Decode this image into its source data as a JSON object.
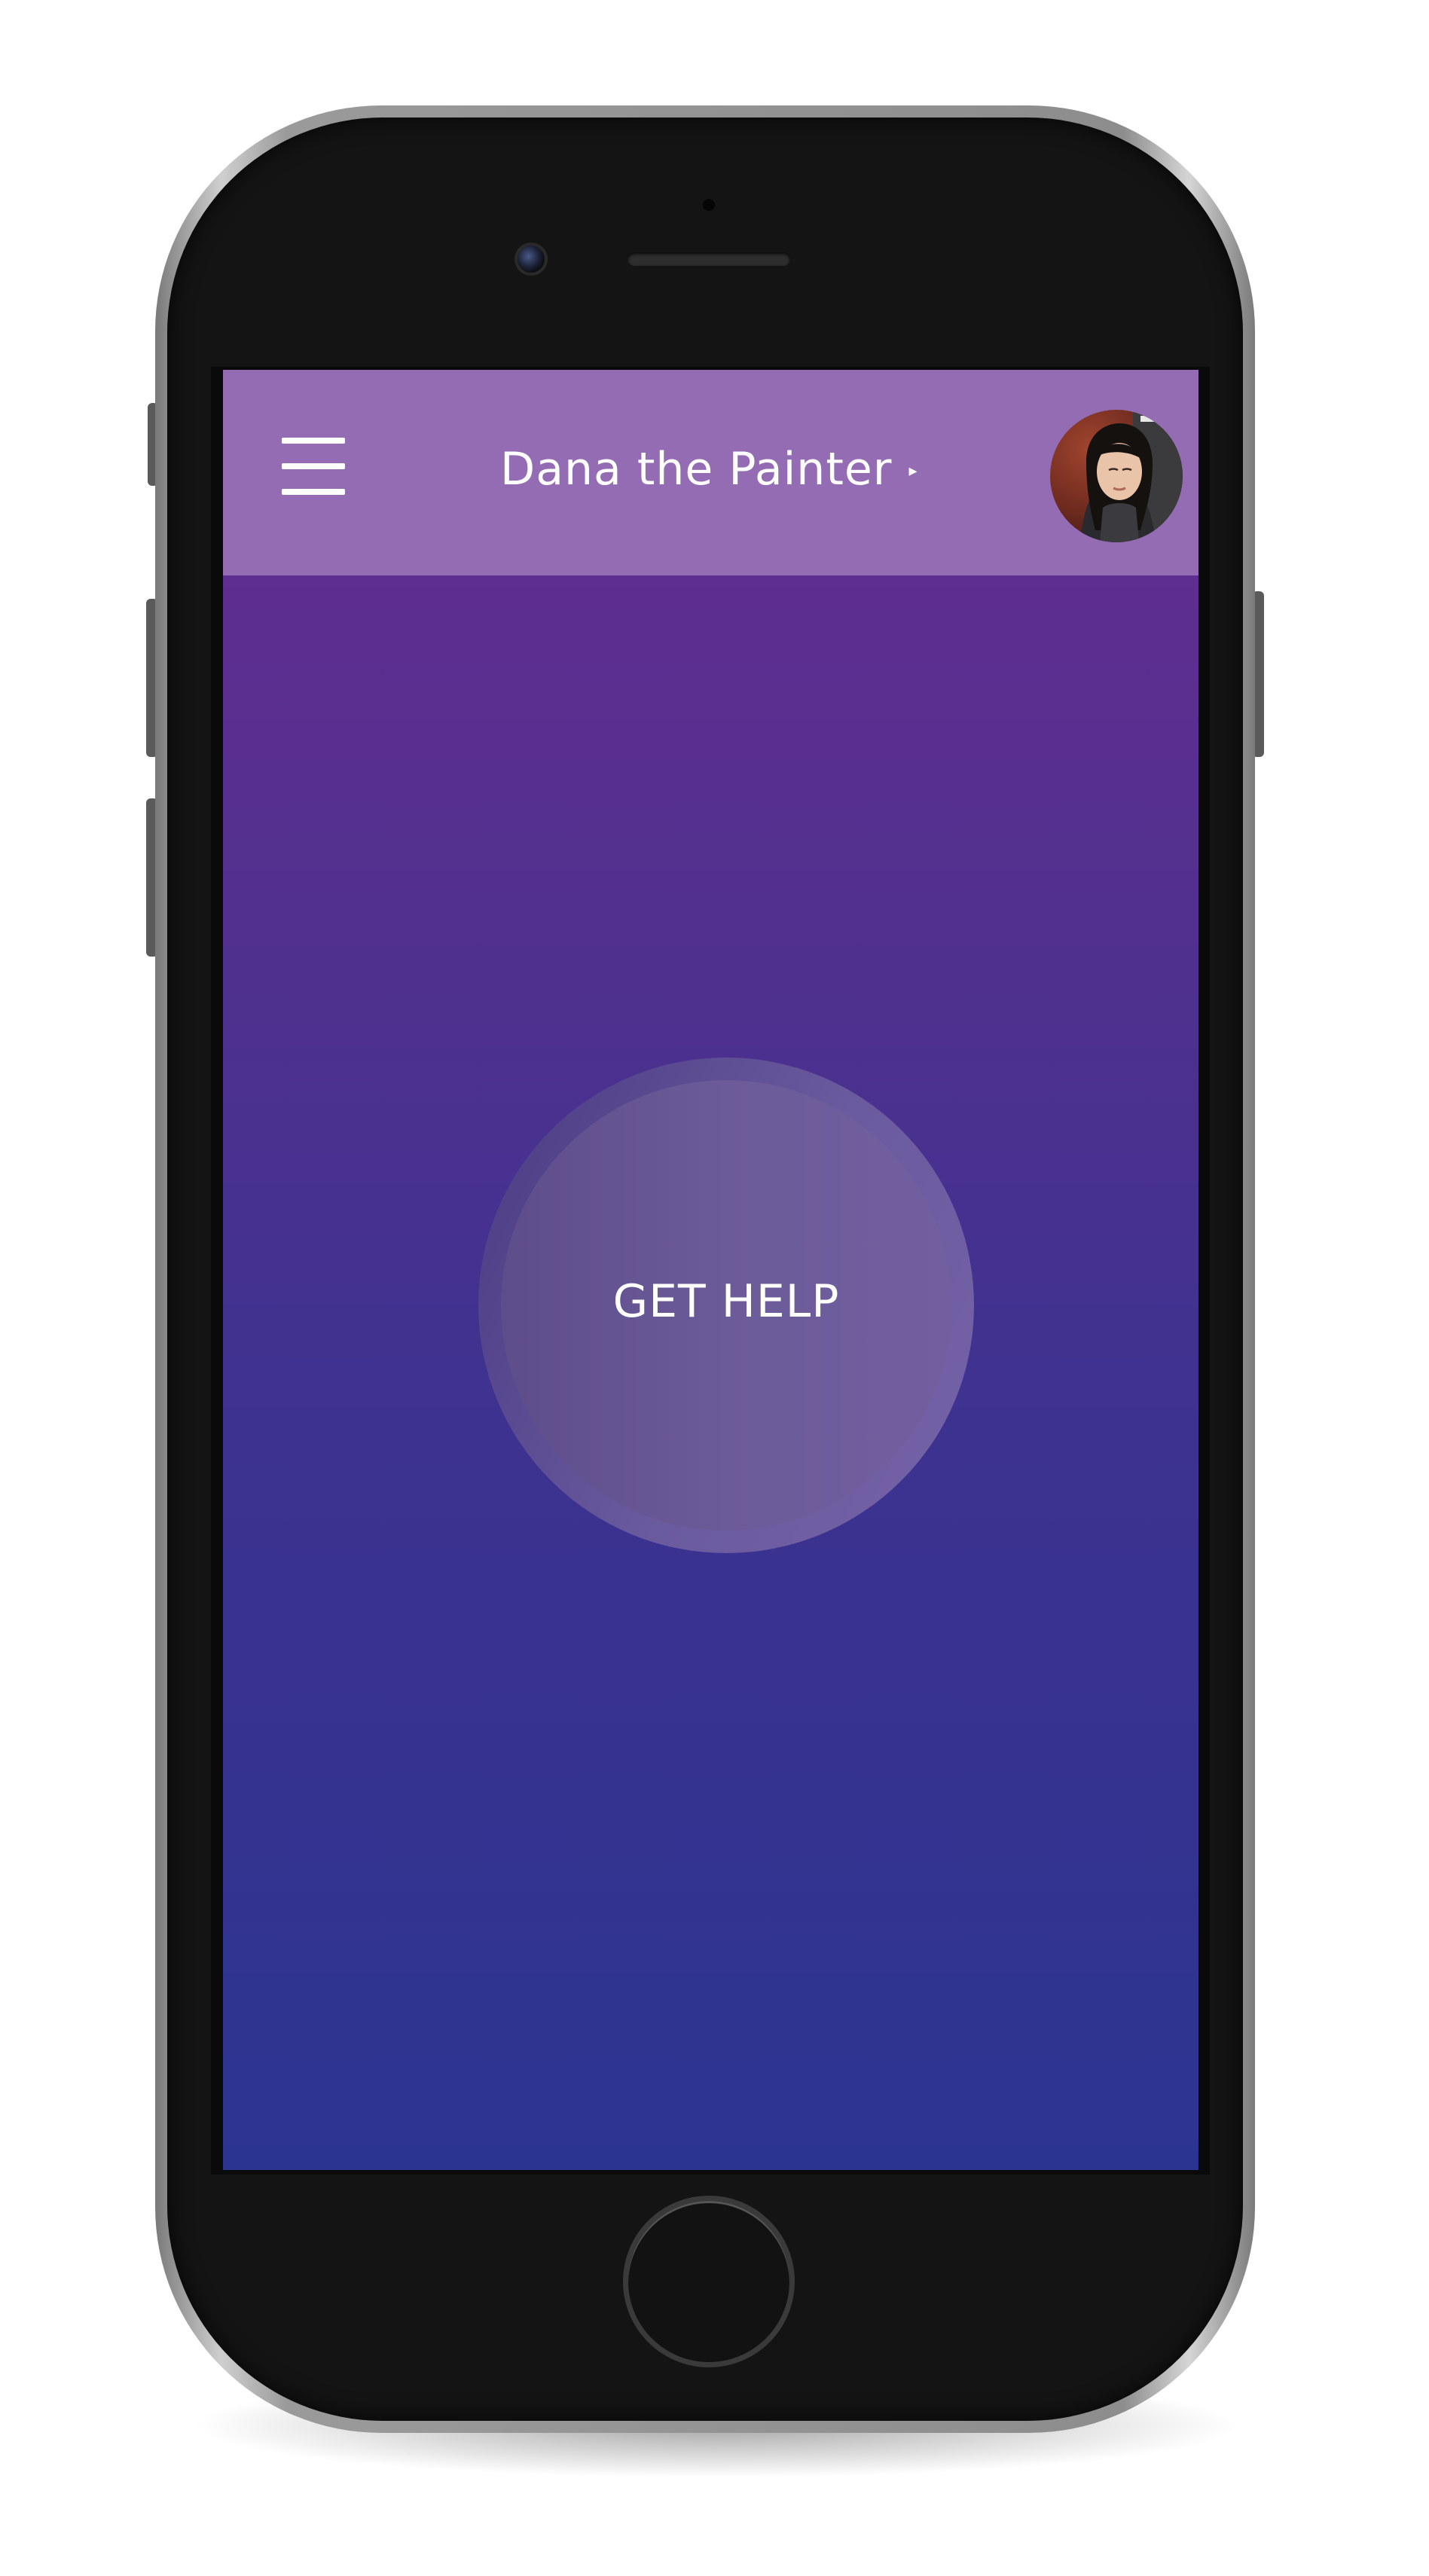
{
  "header": {
    "title": "Dana the Painter",
    "title_caret": "▸",
    "menu_icon": "hamburger-menu-icon",
    "avatar": "profile-avatar"
  },
  "main": {
    "help_button_label": "GET HELP"
  },
  "colors": {
    "header_bg": "#936cb3",
    "screen_gradient_top": "#652d91",
    "screen_gradient_bottom": "#2c3491",
    "button_fill": "#6b5b98",
    "text": "#ffffff"
  }
}
